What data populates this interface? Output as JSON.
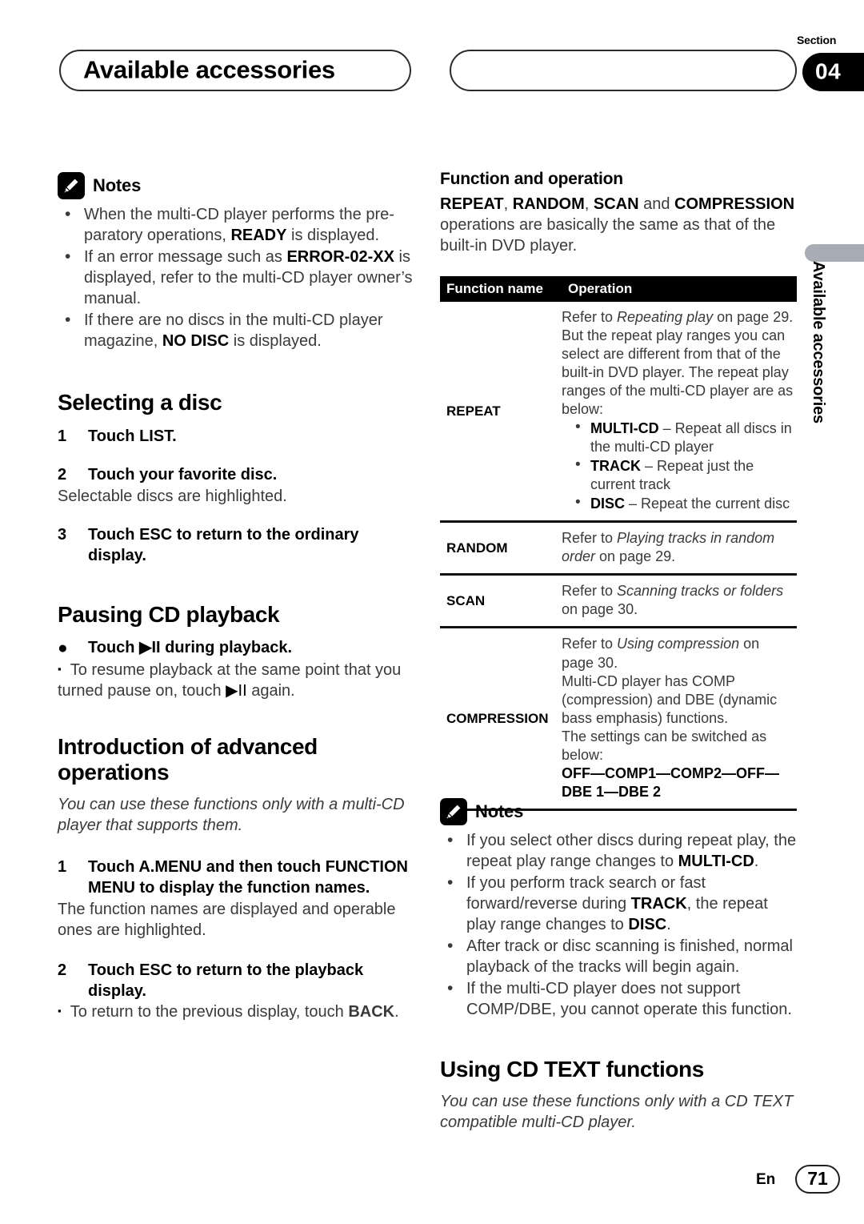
{
  "header": {
    "title": "Available accessories",
    "section_label": "Section",
    "section_number": "04"
  },
  "side_tab": {
    "text": "Available accessories",
    "bar_color": "#a8acb4"
  },
  "left_column": {
    "notes": {
      "icon": "pencil-icon",
      "title": "Notes",
      "items": [
        "When the multi-CD player performs the preparatory operations, READY is displayed.",
        "If an error message such as ERROR-02-XX is displayed, refer to the multi-CD player owner's manual.",
        "If there are no discs in the multi-CD player magazine, NO DISC is displayed."
      ],
      "items_html": [
        "When the multi-CD player performs the pre-paratory operations, <b>READY</b> is displayed.",
        "If an error message such as <b>ERROR-02-XX</b> is displayed, refer to the multi-CD player owner’s manual.",
        "If there are no discs in the multi-CD player magazine, <b>NO DISC</b> is displayed."
      ]
    },
    "selecting_a_disc": {
      "heading": "Selecting a disc",
      "steps": [
        {
          "num": "1",
          "text": "Touch LIST.",
          "sub": ""
        },
        {
          "num": "2",
          "text": "Touch your favorite disc.",
          "sub": "Selectable discs are highlighted."
        },
        {
          "num": "3",
          "text": "Touch ESC to return to the ordinary display.",
          "sub": ""
        }
      ]
    },
    "pausing_cd_playback": {
      "heading": "Pausing CD playback",
      "bullet_marker": "●",
      "bullet_text": "Touch ▶▐▐ during playback.",
      "bullet_text_prefix": "Touch ",
      "bullet_text_suffix": " during playback.",
      "play_pause_glyph": "▶II",
      "sub_marker": "▪",
      "sub_text": "To resume playback at the same point that you turned pause on, touch ▶II again.",
      "sub_text_a": "To resume playback at the same point that you turned pause on, touch ",
      "sub_text_b": " again."
    },
    "advanced": {
      "heading": "Introduction of advanced operations",
      "intro": "You can use these functions only with a multi-CD player that supports them.",
      "steps": [
        {
          "num": "1",
          "text": "Touch A.MENU and then touch FUNCTION MENU to display the function names.",
          "sub": "The function names are displayed and operable ones are highlighted."
        },
        {
          "num": "2",
          "text": "Touch ESC to return to the playback display.",
          "sub": ""
        }
      ],
      "sub_marker": "▪",
      "back_note_a": "To return to the previous display, touch ",
      "back_note_key": "BACK",
      "back_note_b": "."
    }
  },
  "right_column": {
    "function_and_operation": {
      "heading": "Function and operation",
      "intro_html": "<b>REPEAT</b>, <b>RANDOM</b>, <b>SCAN</b> and <b>COMPRESSION</b> operations are basically the same as that of the built-in DVD player."
    },
    "table": {
      "columns": [
        "Function name",
        "Operation"
      ],
      "rows": [
        {
          "name": "REPEAT",
          "operation_html": "Refer to <span class=\"italic\">Repeating play</span> on page 29. But the repeat play ranges you can select are different from that of the built-in DVD player. The repeat play ranges of the multi-CD player are as below:",
          "bullets_html": [
            "<b>MULTI-CD</b> – Repeat all discs in the multi-CD player",
            "<b>TRACK</b> – Repeat just the current track",
            "<b>DISC</b> – Repeat the current disc"
          ]
        },
        {
          "name": "RANDOM",
          "operation_html": "Refer to <span class=\"italic\">Playing tracks in random order</span> on page 29.",
          "bullets_html": []
        },
        {
          "name": "SCAN",
          "operation_html": "Refer to <span class=\"italic\">Scanning tracks or folders</span> on page 30.",
          "bullets_html": []
        },
        {
          "name": "COMPRESSION",
          "operation_html": "Refer to <span class=\"italic\">Using compression</span> on page 30.<br>Multi-CD player has COMP (compression) and DBE (dynamic bass emphasis) functions.<br>The settings can be switched as below:<br><b>OFF—COMP1—COMP2—OFF—<br>DBE 1—DBE 2</b>",
          "bullets_html": []
        }
      ]
    },
    "notes": {
      "icon": "pencil-icon",
      "title": "Notes",
      "items_html": [
        "If you select other discs during repeat play, the repeat play range changes to <b>MULTI-CD</b>.",
        "If you perform track search or fast forward/reverse during <b>TRACK</b>, the repeat play range changes to <b>DISC</b>.",
        "After track or disc scanning is finished, normal playback of the tracks will begin again.",
        "If the multi-CD player does not support COMP/DBE, you cannot operate this function."
      ]
    },
    "using_cd_text": {
      "heading": "Using CD TEXT functions",
      "intro": "You can use these functions only with a CD TEXT compatible multi-CD player."
    }
  },
  "footer": {
    "language": "En",
    "page_number": "71"
  }
}
